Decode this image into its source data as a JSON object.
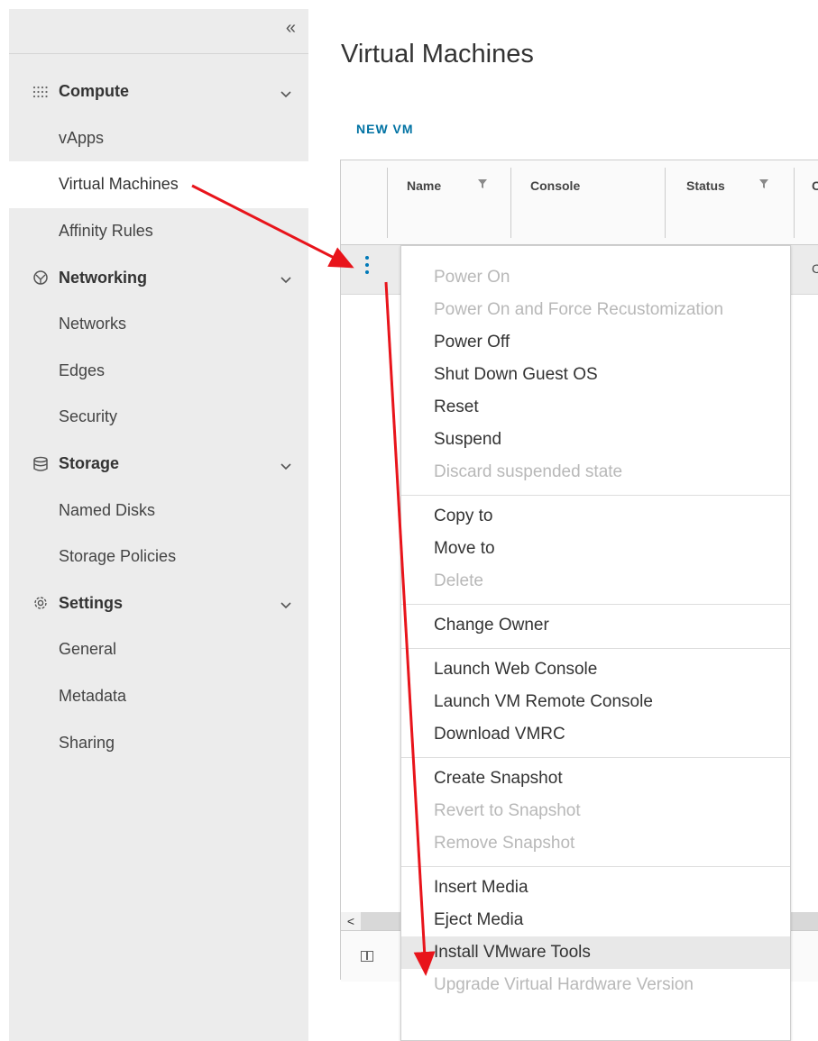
{
  "sidebar": {
    "collapse_glyph": "«",
    "nav": [
      {
        "type": "group",
        "label": "Compute",
        "icon": "dots-grid-icon",
        "name": "compute"
      },
      {
        "type": "item",
        "label": "vApps",
        "name": "vapps"
      },
      {
        "type": "item",
        "label": "Virtual Machines",
        "name": "virtual-machines",
        "active": true
      },
      {
        "type": "item",
        "label": "Affinity Rules",
        "name": "affinity-rules"
      },
      {
        "type": "group",
        "label": "Networking",
        "icon": "network-icon",
        "name": "networking"
      },
      {
        "type": "item",
        "label": "Networks",
        "name": "networks"
      },
      {
        "type": "item",
        "label": "Edges",
        "name": "edges"
      },
      {
        "type": "item",
        "label": "Security",
        "name": "security"
      },
      {
        "type": "group",
        "label": "Storage",
        "icon": "storage-icon",
        "name": "storage"
      },
      {
        "type": "item",
        "label": "Named Disks",
        "name": "named-disks"
      },
      {
        "type": "item",
        "label": "Storage Policies",
        "name": "storage-policies"
      },
      {
        "type": "group",
        "label": "Settings",
        "icon": "gear-icon",
        "name": "settings"
      },
      {
        "type": "item",
        "label": "General",
        "name": "general"
      },
      {
        "type": "item",
        "label": "Metadata",
        "name": "metadata"
      },
      {
        "type": "item",
        "label": "Sharing",
        "name": "sharing"
      }
    ]
  },
  "main": {
    "title": "Virtual Machines",
    "new_vm_label": "NEW VM",
    "grid": {
      "columns": [
        {
          "label": "Name",
          "filterable": true
        },
        {
          "label": "Console",
          "filterable": false
        },
        {
          "label": "Status",
          "filterable": true
        },
        {
          "label": "C",
          "filterable": false
        }
      ],
      "row_partial_value": "C",
      "scroll_left_glyph": "<"
    }
  },
  "context_menu": {
    "groups": [
      [
        {
          "label": "Power On",
          "disabled": true
        },
        {
          "label": "Power On and Force Recustomization",
          "disabled": true
        },
        {
          "label": "Power Off",
          "disabled": false
        },
        {
          "label": "Shut Down Guest OS",
          "disabled": false
        },
        {
          "label": "Reset",
          "disabled": false
        },
        {
          "label": "Suspend",
          "disabled": false
        },
        {
          "label": "Discard suspended state",
          "disabled": true
        }
      ],
      [
        {
          "label": "Copy to",
          "disabled": false
        },
        {
          "label": "Move to",
          "disabled": false
        },
        {
          "label": "Delete",
          "disabled": true
        }
      ],
      [
        {
          "label": "Change Owner",
          "disabled": false
        }
      ],
      [
        {
          "label": "Launch Web Console",
          "disabled": false
        },
        {
          "label": "Launch VM Remote Console",
          "disabled": false
        },
        {
          "label": "Download VMRC",
          "disabled": false
        }
      ],
      [
        {
          "label": "Create Snapshot",
          "disabled": false
        },
        {
          "label": "Revert to Snapshot",
          "disabled": true
        },
        {
          "label": "Remove Snapshot",
          "disabled": true
        }
      ],
      [
        {
          "label": "Insert Media",
          "disabled": false
        },
        {
          "label": "Eject Media",
          "disabled": false
        },
        {
          "label": "Install VMware Tools",
          "disabled": false,
          "highlighted": true
        },
        {
          "label": "Upgrade Virtual Hardware Version",
          "disabled": true
        }
      ]
    ]
  },
  "colors": {
    "sidebar_bg": "#ececec",
    "accent_blue": "#0072a3",
    "annotation_red": "#e8141b",
    "disabled_text": "#b8b8b8"
  }
}
